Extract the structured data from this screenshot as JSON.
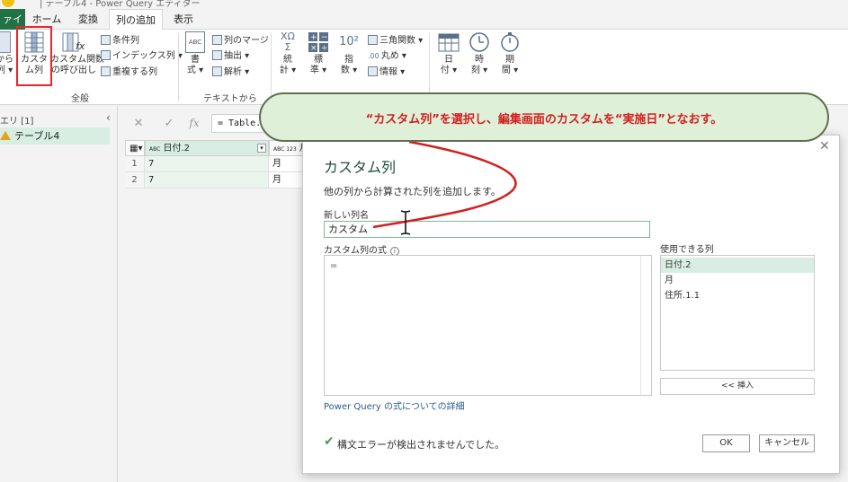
{
  "title_bar": {
    "text": "| テーブル4 - Power Query エディター"
  },
  "tabs": [
    {
      "label": "ァイル"
    },
    {
      "label": "ホーム"
    },
    {
      "label": "変換"
    },
    {
      "label": "列の追加"
    },
    {
      "label": "表示"
    }
  ],
  "ribbon": {
    "from_example_label": "から\n列 ▾",
    "custom_column_label": "カスタ\nム列",
    "invoke_custom_function_label": "カスタム関数\nの呼び出し",
    "conditional_column": "条件列",
    "index_column": "インデックス列 ▾",
    "duplicate_column": "重複する列",
    "group_general": "全般",
    "format_label": "書\n式 ▾",
    "merge_columns": "列のマージ",
    "extract": "抽出 ▾",
    "parse": "解析 ▾",
    "group_text": "テキストから",
    "statistics_label": "統\n計 ▾",
    "standard_label": "標\n準 ▾",
    "scientific_label": "指\n数 ▾",
    "trig": "三角関数 ▾",
    "rounding": "丸め ▾",
    "information": "情報 ▾",
    "date_label": "日\n付 ▾",
    "time_label": "時\n刻 ▾",
    "duration_label": "期\n間 ▾",
    "icon_format_text": "ABC",
    "icon_extract_text": "ABC 123",
    "icon_stats_text": "XΩ Σ",
    "icon_scientific_text": "10²",
    "icon_rounding_text": ".00"
  },
  "left_panel": {
    "header": "エリ [1]",
    "query_name": "テーブル4"
  },
  "formula_bar": {
    "text": "= Table.",
    "fx": "fx"
  },
  "grid": {
    "columns": [
      {
        "type": "ABC",
        "name": "日付.2"
      },
      {
        "type": "ABC 123",
        "name": "月"
      }
    ],
    "rows": [
      {
        "num": "1",
        "cells": [
          "7",
          "月"
        ]
      },
      {
        "num": "2",
        "cells": [
          "7",
          "月"
        ]
      }
    ]
  },
  "callout": {
    "text": "“カスタム列”を選択し、編集画面のカスタムを“実施日”となおす。"
  },
  "dialog": {
    "title": "カスタム列",
    "subtitle": "他の列から計算された列を追加します。",
    "new_column_label": "新しい列名",
    "new_column_value": "カスタム",
    "formula_label": "カスタム列の式",
    "formula_value": "=",
    "available_columns_label": "使用できる列",
    "available_columns": [
      "日付.2",
      "月",
      "住所.1.1"
    ],
    "insert_button": "<< 挿入",
    "learn_more_link": "Power Query の式についての詳細",
    "status": "構文エラーが検出されませんでした。",
    "ok_button": "OK",
    "cancel_button": "キャンセル"
  },
  "colors": {
    "accent_green": "#217346",
    "callout_fill": "#dff0d8",
    "callout_text": "#d21f1f",
    "highlight_red": "#e8262b"
  }
}
